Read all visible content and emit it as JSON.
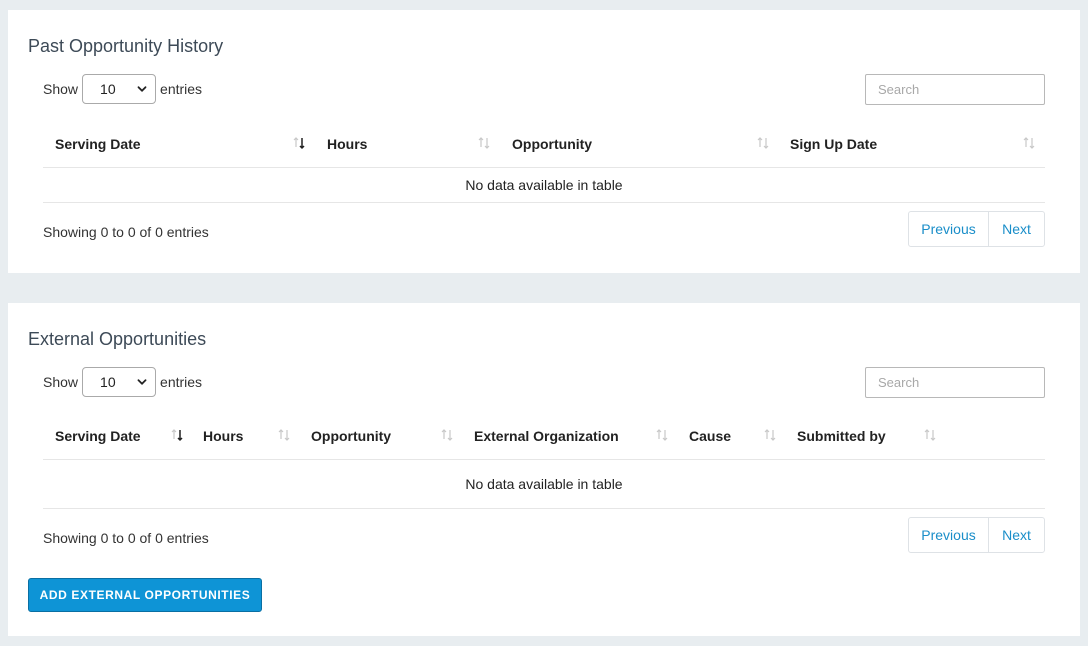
{
  "past": {
    "title": "Past Opportunity History",
    "show_label": "Show",
    "page_size": "10",
    "entries_label": "entries",
    "search_placeholder": "Search",
    "columns": [
      "Serving Date",
      "Hours",
      "Opportunity",
      "Sign Up Date"
    ],
    "empty_message": "No data available in table",
    "info": "Showing 0 to 0 of 0 entries",
    "previous_label": "Previous",
    "next_label": "Next"
  },
  "external": {
    "title": "External Opportunities",
    "show_label": "Show",
    "page_size": "10",
    "entries_label": "entries",
    "search_placeholder": "Search",
    "columns": [
      "Serving Date",
      "Hours",
      "Opportunity",
      "External Organization",
      "Cause",
      "Submitted by"
    ],
    "empty_message": "No data available in table",
    "info": "Showing 0 to 0 of 0 entries",
    "previous_label": "Previous",
    "next_label": "Next",
    "add_button_label": "ADD EXTERNAL OPPORTUNITIES"
  },
  "colors": {
    "accent": "#0e94d6",
    "link": "#1a8ec9",
    "page_background": "#e8edf0"
  }
}
